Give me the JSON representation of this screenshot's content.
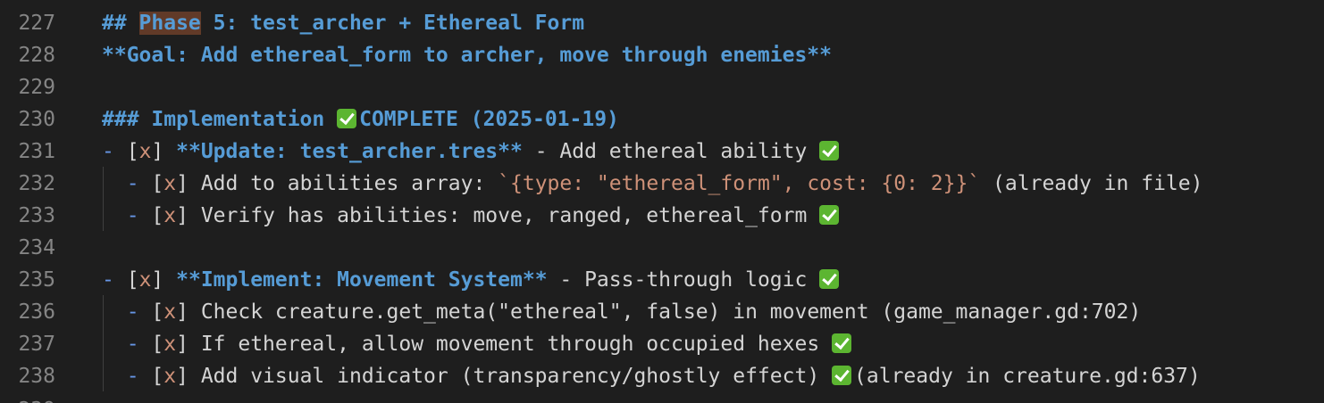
{
  "editor": {
    "lines": [
      {
        "num": "227",
        "parts": [
          {
            "t": "## ",
            "c": "md-head"
          },
          {
            "t": "Phase",
            "c": "md-head hl"
          },
          {
            "t": " 5: test_archer + Ethereal Form",
            "c": "md-head"
          }
        ]
      },
      {
        "num": "228",
        "parts": [
          {
            "t": "**Goal: Add ethereal_form to archer, move through enemies**",
            "c": "md-bold"
          }
        ]
      },
      {
        "num": "229",
        "parts": []
      },
      {
        "num": "230",
        "parts": [
          {
            "t": "### Implementation ",
            "c": "md-head"
          },
          {
            "check": true
          },
          {
            "t": "COMPLETE (2025-01-19)",
            "c": "md-head"
          }
        ]
      },
      {
        "num": "231",
        "parts": [
          {
            "t": "- ",
            "c": "md-bullet"
          },
          {
            "t": "[",
            "c": "md-bracket"
          },
          {
            "t": "x",
            "c": "md-x"
          },
          {
            "t": "] ",
            "c": "md-bracket"
          },
          {
            "t": "**Update: test_archer.tres**",
            "c": "md-bold"
          },
          {
            "t": " - Add ethereal ability ",
            "c": "plain"
          },
          {
            "check": true
          }
        ]
      },
      {
        "num": "232",
        "parts": [
          {
            "t": "  - ",
            "c": "md-bullet"
          },
          {
            "t": "[",
            "c": "md-bracket"
          },
          {
            "t": "x",
            "c": "md-x"
          },
          {
            "t": "] ",
            "c": "md-bracket"
          },
          {
            "t": "Add to abilities array: ",
            "c": "plain"
          },
          {
            "t": "`{type: \"ethereal_form\", cost: {0: 2}}`",
            "c": "md-code"
          },
          {
            "t": " (already in file)",
            "c": "plain"
          }
        ]
      },
      {
        "num": "233",
        "parts": [
          {
            "t": "  - ",
            "c": "md-bullet"
          },
          {
            "t": "[",
            "c": "md-bracket"
          },
          {
            "t": "x",
            "c": "md-x"
          },
          {
            "t": "] ",
            "c": "md-bracket"
          },
          {
            "t": "Verify has abilities: move, ranged, ethereal_form ",
            "c": "plain"
          },
          {
            "check": true
          }
        ]
      },
      {
        "num": "234",
        "parts": []
      },
      {
        "num": "235",
        "parts": [
          {
            "t": "- ",
            "c": "md-bullet"
          },
          {
            "t": "[",
            "c": "md-bracket"
          },
          {
            "t": "x",
            "c": "md-x"
          },
          {
            "t": "] ",
            "c": "md-bracket"
          },
          {
            "t": "**Implement: Movement System**",
            "c": "md-bold"
          },
          {
            "t": " - Pass-through logic ",
            "c": "plain"
          },
          {
            "check": true
          }
        ]
      },
      {
        "num": "236",
        "parts": [
          {
            "t": "  - ",
            "c": "md-bullet"
          },
          {
            "t": "[",
            "c": "md-bracket"
          },
          {
            "t": "x",
            "c": "md-x"
          },
          {
            "t": "] ",
            "c": "md-bracket"
          },
          {
            "t": "Check creature.get_meta(\"ethereal\", false) in movement (game_manager.gd:702)",
            "c": "plain"
          }
        ]
      },
      {
        "num": "237",
        "parts": [
          {
            "t": "  - ",
            "c": "md-bullet"
          },
          {
            "t": "[",
            "c": "md-bracket"
          },
          {
            "t": "x",
            "c": "md-x"
          },
          {
            "t": "] ",
            "c": "md-bracket"
          },
          {
            "t": "If ethereal, allow movement through occupied hexes ",
            "c": "plain"
          },
          {
            "check": true
          }
        ]
      },
      {
        "num": "238",
        "parts": [
          {
            "t": "  - ",
            "c": "md-bullet"
          },
          {
            "t": "[",
            "c": "md-bracket"
          },
          {
            "t": "x",
            "c": "md-x"
          },
          {
            "t": "] ",
            "c": "md-bracket"
          },
          {
            "t": "Add visual indicator (transparency/ghostly effect) ",
            "c": "plain"
          },
          {
            "check": true
          },
          {
            "t": "(already in creature.gd:637)",
            "c": "plain"
          }
        ]
      }
    ],
    "next_line_num": "239"
  }
}
